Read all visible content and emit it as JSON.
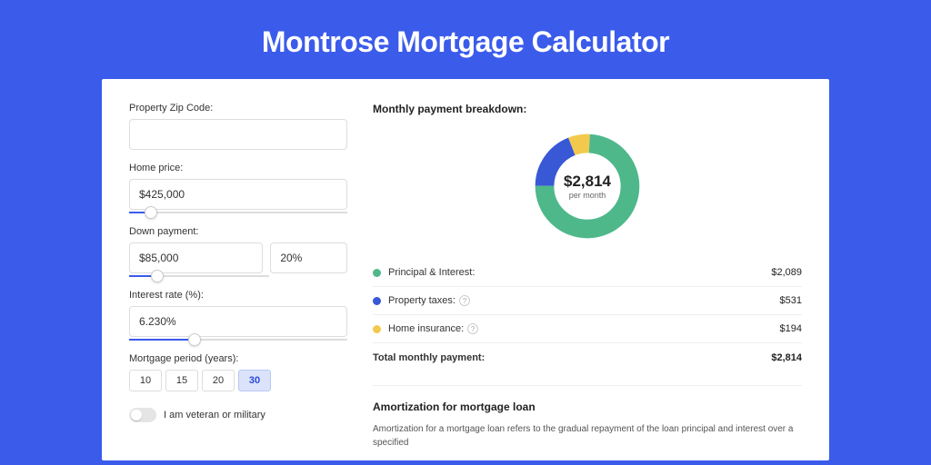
{
  "title": "Montrose Mortgage Calculator",
  "form": {
    "zip_label": "Property Zip Code:",
    "zip_value": "",
    "home_price_label": "Home price:",
    "home_price_value": "$425,000",
    "home_price_slider_pct": 10,
    "down_payment_label": "Down payment:",
    "down_payment_value": "$85,000",
    "down_payment_pct_value": "20%",
    "down_payment_slider_pct": 20,
    "interest_label": "Interest rate (%):",
    "interest_value": "6.230%",
    "interest_slider_pct": 30,
    "period_label": "Mortgage period (years):",
    "periods": [
      "10",
      "15",
      "20",
      "30"
    ],
    "period_active_index": 3,
    "veteran_label": "I am veteran or military",
    "veteran_on": false
  },
  "breakdown": {
    "title": "Monthly payment breakdown:",
    "center_amount": "$2,814",
    "center_sub": "per month",
    "items": [
      {
        "label": "Principal & Interest:",
        "value": "$2,089",
        "color": "#4eb88b",
        "pct": 74.2,
        "has_help": false
      },
      {
        "label": "Property taxes:",
        "value": "$531",
        "color": "#3858d6",
        "pct": 18.9,
        "has_help": true
      },
      {
        "label": "Home insurance:",
        "value": "$194",
        "color": "#f2c94c",
        "pct": 6.9,
        "has_help": true
      }
    ],
    "total_label": "Total monthly payment:",
    "total_value": "$2,814"
  },
  "amortization": {
    "title": "Amortization for mortgage loan",
    "text": "Amortization for a mortgage loan refers to the gradual repayment of the loan principal and interest over a specified"
  },
  "chart_data": {
    "type": "pie",
    "title": "Monthly payment breakdown",
    "series": [
      {
        "name": "Principal & Interest",
        "value": 2089
      },
      {
        "name": "Property taxes",
        "value": 531
      },
      {
        "name": "Home insurance",
        "value": 194
      }
    ],
    "total": 2814,
    "unit": "USD per month"
  }
}
